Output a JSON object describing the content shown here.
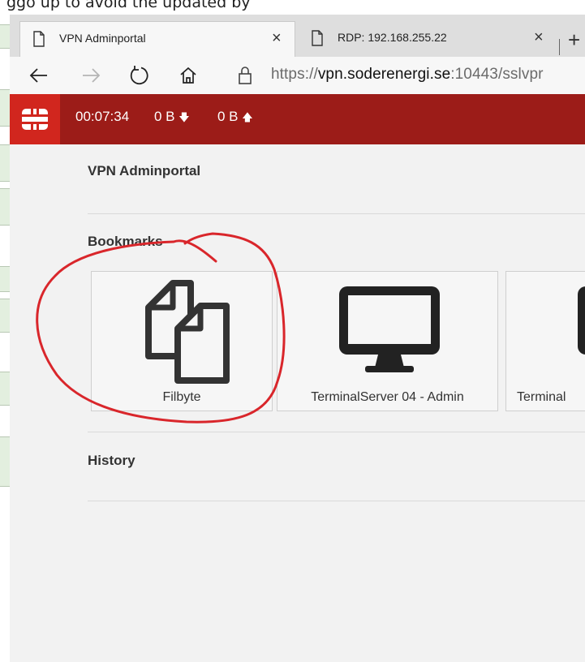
{
  "top_strip": {
    "text": "ggo up to avoid the updated by"
  },
  "browser": {
    "tabs": [
      {
        "title": "VPN Adminportal",
        "close": "×"
      },
      {
        "title": "RDP: 192.168.255.22",
        "close": "×"
      }
    ],
    "new_tab": "+",
    "url": {
      "scheme": "https://",
      "host": "vpn.soderenergi.se",
      "rest": ":10443/sslvpr"
    }
  },
  "header": {
    "timer": "00:07:34",
    "download": "0 B",
    "download_arrow": "🡇",
    "upload": "0 B",
    "upload_arrow": "🡅",
    "bg_color": "#9c1c18",
    "logo_color": "#d1261e"
  },
  "portal": {
    "title": "VPN Adminportal"
  },
  "bookmarks": {
    "heading": "Bookmarks",
    "items": [
      {
        "label": "Filbyte",
        "icon": "files-icon"
      },
      {
        "label": "TerminalServer 04 - Admin",
        "icon": "monitor-icon"
      },
      {
        "label": "Terminal",
        "icon": "monitor-icon"
      }
    ]
  },
  "history": {
    "heading": "History"
  },
  "annotation_color": "#d9262b"
}
